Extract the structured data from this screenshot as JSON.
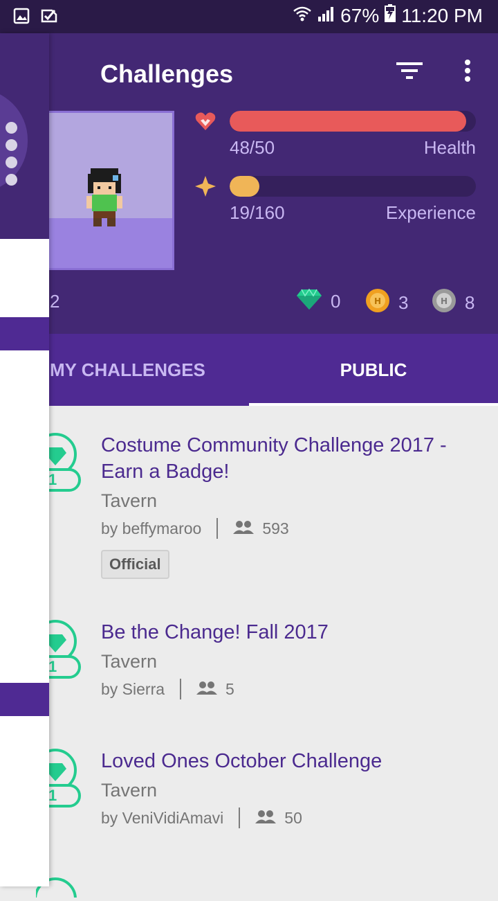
{
  "status_bar": {
    "battery": "67%",
    "time": "11:20 PM",
    "icons": [
      "image-icon",
      "check-notify-icon",
      "wifi-icon",
      "signal-icon",
      "battery-charging-icon"
    ]
  },
  "header": {
    "title": "Challenges",
    "actions": [
      "filter-icon",
      "more-vert-icon"
    ],
    "stats": {
      "health": {
        "value": "48/50",
        "label": "Health",
        "fraction": 0.96,
        "color": "#e85a5a"
      },
      "experience": {
        "value": "19/160",
        "label": "Experience",
        "fraction": 0.12,
        "color": "#f0b557"
      }
    },
    "level_fragment": "2",
    "currencies": {
      "gems": "0",
      "gold": "3",
      "hourglasses": "8"
    }
  },
  "tabs": {
    "my": "MY CHALLENGES",
    "public": "PUBLIC"
  },
  "challenges": [
    {
      "title": "Costume Community Challenge 2017 - Earn a Badge!",
      "group": "Tavern",
      "leader": "by beffymaroo",
      "members": "593",
      "tag": "Official",
      "prize": "1"
    },
    {
      "title": "Be the Change! Fall 2017",
      "group": "Tavern",
      "leader": "by Sierra",
      "members": "5",
      "prize": "1"
    },
    {
      "title": "Loved Ones October Challenge",
      "group": "Tavern",
      "leader": "by VeniVidiAmavi",
      "members": "50",
      "prize": "1"
    }
  ],
  "colors": {
    "header": "#432874",
    "tabbar": "#4f2a93",
    "accent_title": "#4b2a8f",
    "gem": "#24cc8f"
  }
}
